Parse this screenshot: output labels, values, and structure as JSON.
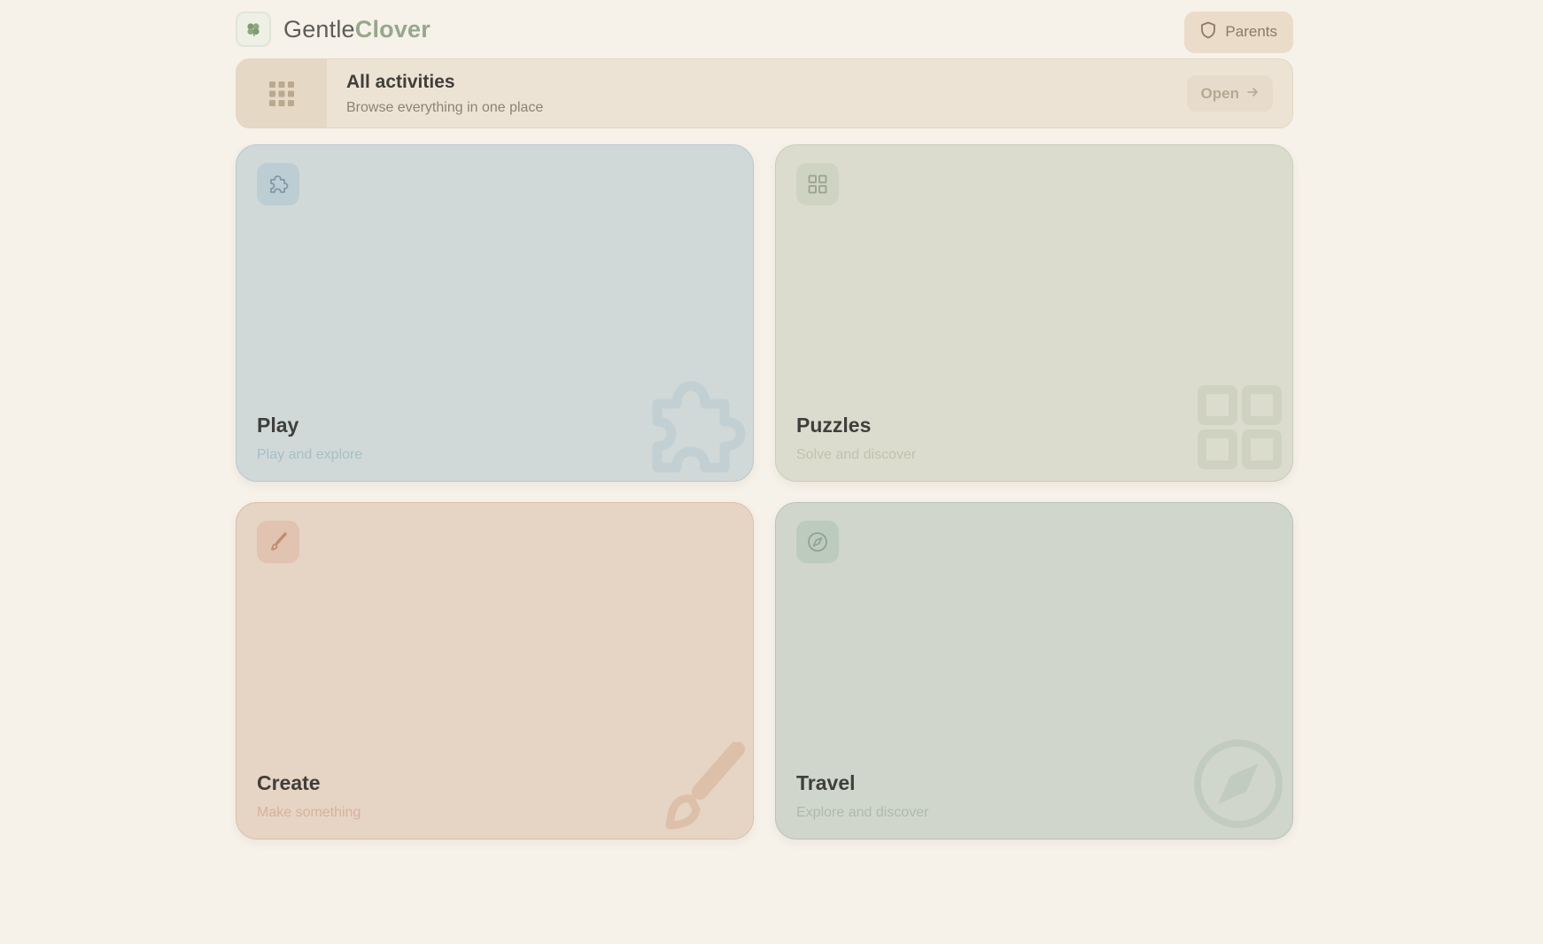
{
  "header": {
    "brand_first": "Gentle",
    "brand_second": "Clover",
    "logo_icon": "clover-icon",
    "parents_label": "Parents",
    "parents_icon": "shield-icon"
  },
  "banner": {
    "icon": "grid-dots-icon",
    "title": "All activities",
    "subtitle": "Browse everything in one place",
    "open_label": "Open",
    "open_icon": "arrow-right-icon"
  },
  "cards": [
    {
      "title": "Play",
      "subtitle": "Play and explore",
      "icon": "puzzle-icon",
      "color": "#d0d9d8"
    },
    {
      "title": "Puzzles",
      "subtitle": "Solve and discover",
      "icon": "grid-icon",
      "color": "#dbdccd"
    },
    {
      "title": "Create",
      "subtitle": "Make something",
      "icon": "brush-icon",
      "color": "#e6d4c4"
    },
    {
      "title": "Travel",
      "subtitle": "Explore and discover",
      "icon": "compass-icon",
      "color": "#d0d6cb"
    }
  ],
  "colors": {
    "background": "#f6f1e9",
    "brand_accent": "#96a88a"
  }
}
